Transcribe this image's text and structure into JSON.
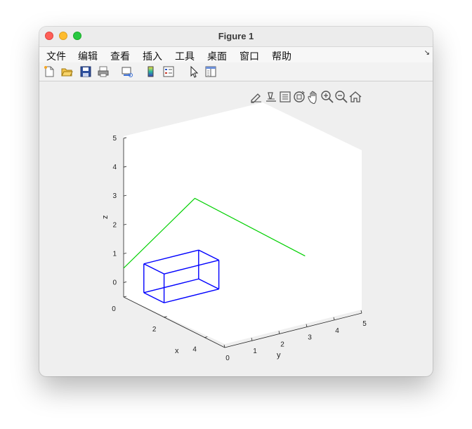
{
  "window": {
    "title": "Figure 1"
  },
  "menu": {
    "items": [
      "文件",
      "编辑",
      "查看",
      "插入",
      "工具",
      "桌面",
      "窗口",
      "帮助"
    ],
    "overflow_icon": "dock-arrow-icon"
  },
  "toolbar": {
    "buttons": [
      "new-figure-icon",
      "open-file-icon",
      "save-icon",
      "print-icon",
      "link-plot-icon",
      "insert-colorbar-icon",
      "insert-legend-icon",
      "edit-plot-pointer-icon",
      "property-inspector-icon"
    ]
  },
  "axes_toolbar": {
    "buttons": [
      "brush-data-icon",
      "data-tips-icon",
      "link-icon",
      "rotate-3d-icon",
      "pan-hand-icon",
      "zoom-in-icon",
      "zoom-out-icon",
      "home-restore-view-icon"
    ]
  },
  "chart_data": {
    "type": "3d-line",
    "xlabel": "x",
    "ylabel": "y",
    "zlabel": "z",
    "xlim": [
      0,
      5
    ],
    "ylim": [
      0,
      5
    ],
    "zlim": [
      -0.5,
      5
    ],
    "x_ticks": [
      "0",
      "2",
      "4"
    ],
    "y_ticks": [
      "0",
      "1",
      "2",
      "3",
      "4",
      "5"
    ],
    "z_ticks": [
      "0",
      "1",
      "2",
      "3",
      "4",
      "5"
    ],
    "series": [
      {
        "color": "#0000ff",
        "kind": "wire-box",
        "segments": [
          [
            [
              1,
              0,
              0
            ],
            [
              2,
              0,
              0
            ]
          ],
          [
            [
              2,
              0,
              0
            ],
            [
              2,
              2,
              0
            ]
          ],
          [
            [
              2,
              2,
              0
            ],
            [
              1,
              2,
              0
            ]
          ],
          [
            [
              1,
              2,
              0
            ],
            [
              1,
              0,
              0
            ]
          ],
          [
            [
              1,
              0,
              1
            ],
            [
              2,
              0,
              1
            ]
          ],
          [
            [
              2,
              0,
              1
            ],
            [
              2,
              2,
              1
            ]
          ],
          [
            [
              2,
              2,
              1
            ],
            [
              1,
              2,
              1
            ]
          ],
          [
            [
              1,
              2,
              1
            ],
            [
              1,
              0,
              1
            ]
          ],
          [
            [
              1,
              0,
              0
            ],
            [
              1,
              0,
              1
            ]
          ],
          [
            [
              2,
              0,
              0
            ],
            [
              2,
              0,
              1
            ]
          ],
          [
            [
              2,
              2,
              0
            ],
            [
              2,
              2,
              1
            ]
          ],
          [
            [
              1,
              2,
              0
            ],
            [
              1,
              2,
              1
            ]
          ]
        ]
      },
      {
        "color": "#00d000",
        "kind": "polyline",
        "points": [
          [
            0,
            0,
            0.5
          ],
          [
            0,
            2.6,
            2.3
          ],
          [
            2.2,
            5,
            0.5
          ]
        ]
      }
    ]
  }
}
